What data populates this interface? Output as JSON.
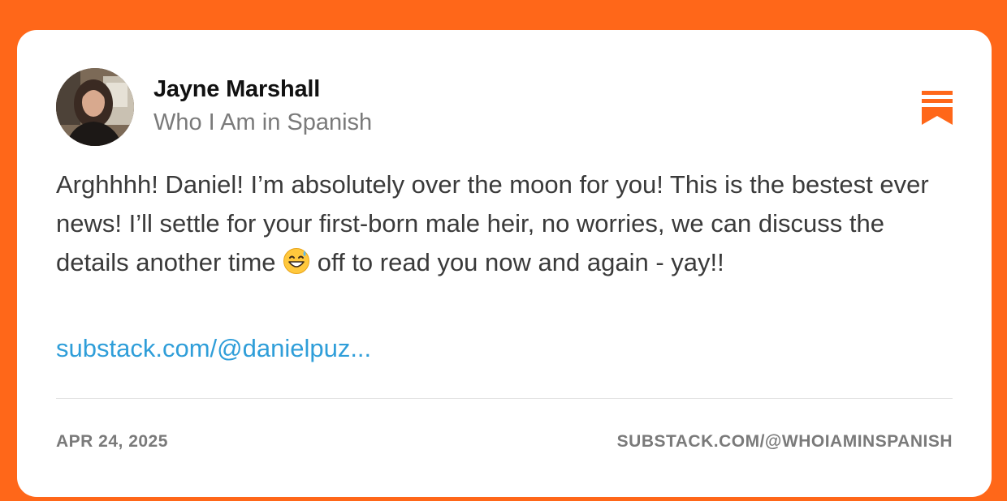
{
  "colors": {
    "background": "#FF6719",
    "card": "#FFFFFF",
    "accent": "#FF6719",
    "link": "#2F9ED9",
    "muted_text": "#7A7A7A"
  },
  "author": {
    "name": "Jayne Marshall",
    "publication": "Who I Am in Spanish",
    "avatar_icon": "profile-photo"
  },
  "bookmark_icon": "bookmark-icon",
  "comment": {
    "text_before_emoji": "Arghhhh! Daniel! I’m absolutely over the moon for you! This is the bestest ever news! I’ll settle for your first-born male heir, no worries, we can discuss the details another time",
    "emoji": "grinning-face-with-sweat",
    "text_after_emoji": "off to read you now and again - yay!!"
  },
  "link": {
    "text": "substack.com/@danielpuz..."
  },
  "footer": {
    "date": "APR 24, 2025",
    "profile_url": "SUBSTACK.COM/@WHOIAMINSPANISH"
  }
}
